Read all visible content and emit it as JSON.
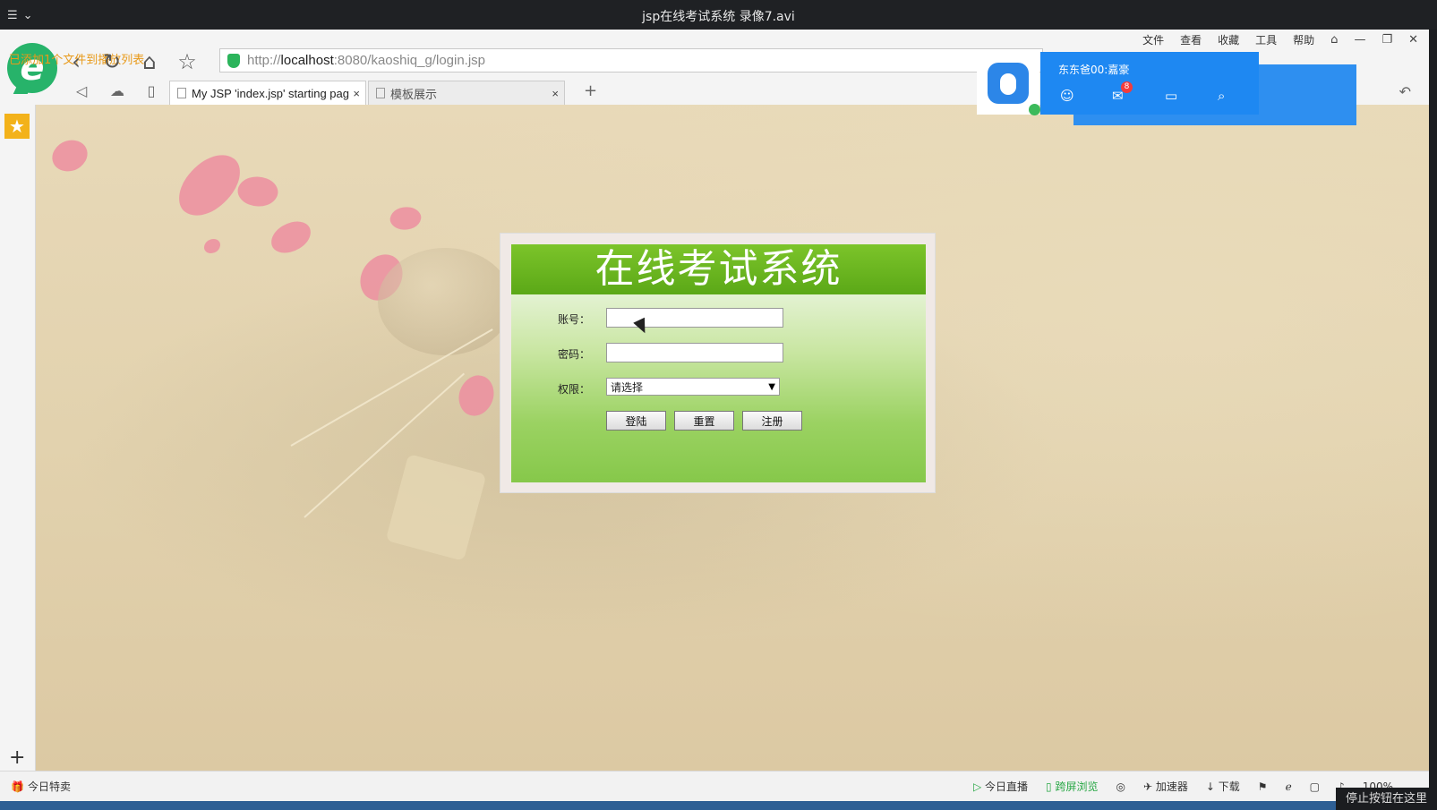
{
  "player": {
    "title": "jsp在线考试系统 录像7.avi",
    "menu_icon": "list-icon"
  },
  "browser": {
    "menu": {
      "file": "文件",
      "view": "查看",
      "favorites": "收藏",
      "tools": "工具",
      "help": "帮助"
    },
    "overlay_text": "已添加1个文件到播放列表",
    "url_prefix": "http://",
    "url_host": "localhost",
    "url_rest": ":8080/kaoshiq_g/login.jsp",
    "tabs": [
      {
        "label": "My JSP 'index.jsp' starting pag",
        "active": true
      },
      {
        "label": "模板展示",
        "active": false
      }
    ]
  },
  "login": {
    "title": "在线考试系统",
    "account_label": "账号：",
    "account_value": "",
    "password_label": "密码：",
    "password_value": "",
    "role_label": "权限：",
    "role_selected": "请选择",
    "login_button": "登陆",
    "reset_button": "重置",
    "register_button": "注册"
  },
  "notification": {
    "name": "东东爸00:嘉豪",
    "mail_count": "8"
  },
  "statusbar": {
    "today_deals": "今日特卖",
    "live": "今日直播",
    "cross_screen": "跨屏浏览",
    "accelerator": "加速器",
    "download": "下载",
    "zoom": "100%"
  },
  "stop_note": "停止按钮在这里",
  "colors": {
    "login_green": "#6ebd23",
    "notif_blue": "#1e88f2",
    "accent_green": "#27b36a"
  }
}
